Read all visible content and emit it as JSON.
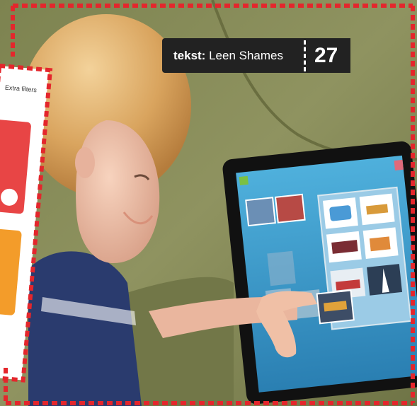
{
  "byline": {
    "label": "tekst:",
    "author": "Leen Shames",
    "page_number": "27"
  },
  "tablet_screenshot": {
    "button_text": "Extra filters"
  },
  "colors": {
    "border_red": "#e4262c",
    "byline_bg": "#222222",
    "sofa_green": "#8a8e5a",
    "tablet_screen_blue": "#3a97c8"
  }
}
